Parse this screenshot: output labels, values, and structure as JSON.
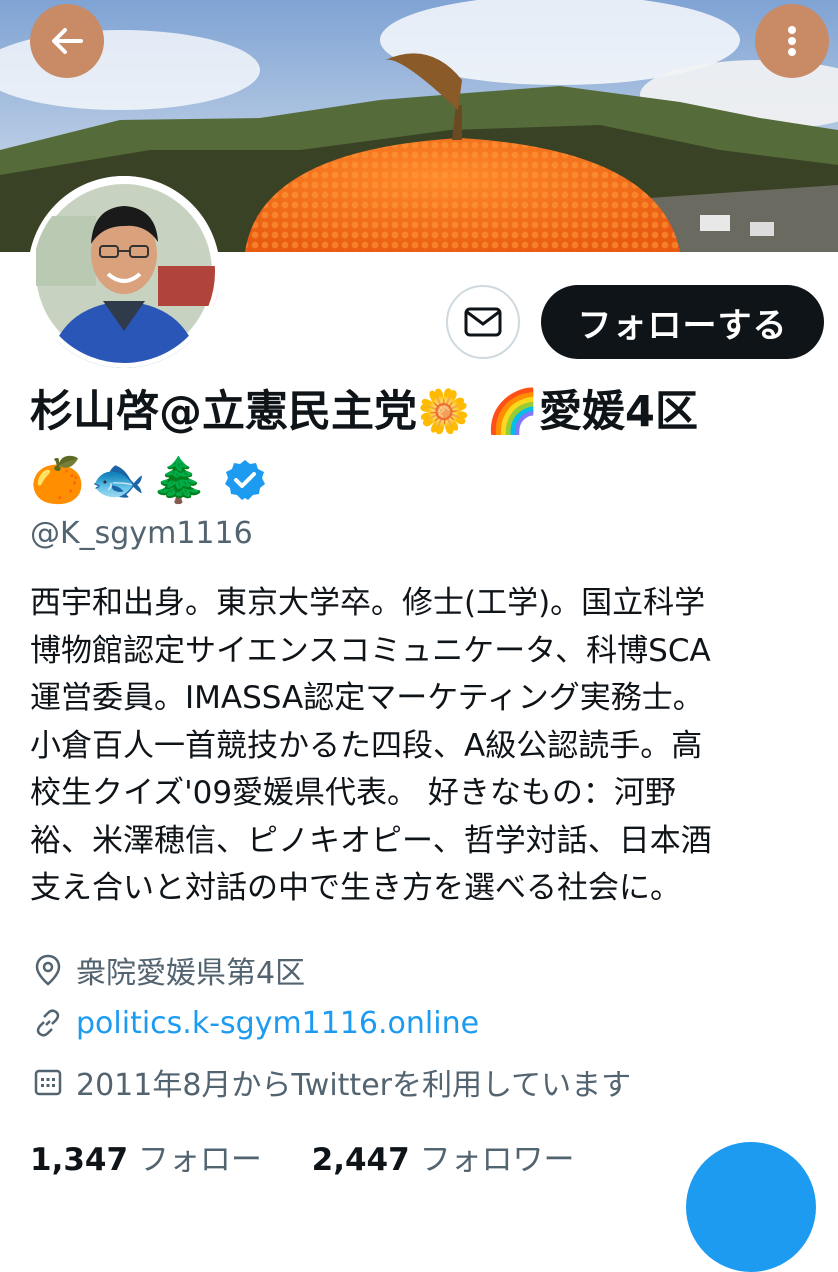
{
  "header": {
    "back_icon": "arrow-left-icon",
    "more_icon": "more-vertical-icon",
    "banner_description_colors": {
      "sky": "#9fbde0",
      "hill": "#3d4a2c",
      "orange": "#f0701e"
    }
  },
  "profile": {
    "display_name": "杉山啓@立憲民主党🌼 🌈愛媛4区",
    "badge_emojis": [
      "🍊",
      "🐟",
      "🌲"
    ],
    "verified_icon": "verified-badge-icon",
    "handle": "@K_sgym1116",
    "bio_lines": [
      "西宇和出身。東京大学卒。修士(工学)。国立科学",
      "博物館認定サイエンスコミュニケータ、科博SCA",
      "運営委員。IMASSA認定マーケティング実務士。",
      "小倉百人一首競技かるた四段、A級公認読手。高",
      "校生クイズ'09愛媛県代表。 好きなもの：河野",
      "裕、米澤穂信、ピノキオピー、哲学対話、日本酒",
      "支え合いと対話の中で生き方を選べる社会に。"
    ],
    "location": "衆院愛媛県第4区",
    "website": "politics.k-sgym1116.online",
    "joined": "2011年8月からTwitterを利用しています",
    "following_count": "1,347",
    "following_label": "フォロー",
    "followers_count": "2,447",
    "followers_label": "フォロワー"
  },
  "actions": {
    "follow_label": "フォローする",
    "message_icon": "envelope-icon"
  },
  "colors": {
    "accent": "#1d9bf0",
    "button_dark": "#0f1419",
    "secondary_text": "#536471",
    "header_buttons": "#c98a66"
  }
}
